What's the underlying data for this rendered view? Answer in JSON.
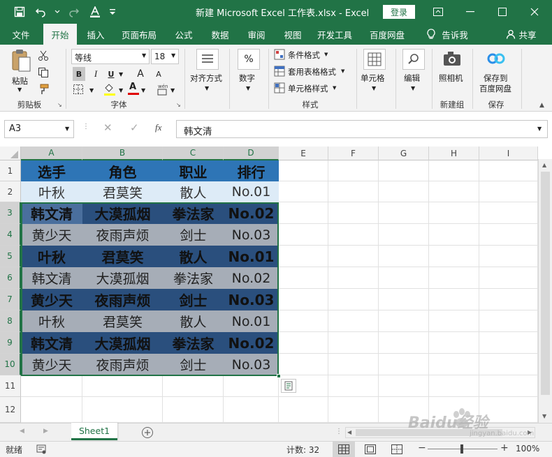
{
  "titlebar": {
    "title": "新建 Microsoft Excel 工作表.xlsx - Excel",
    "login": "登录"
  },
  "tabs": [
    "文件",
    "开始",
    "插入",
    "页面布局",
    "公式",
    "数据",
    "审阅",
    "视图",
    "开发工具",
    "百度网盘",
    "告诉我",
    "共享"
  ],
  "ribbon": {
    "paste": "粘贴",
    "clipboard": "剪贴板",
    "font_name": "等线",
    "font_size": "18",
    "bold": "B",
    "italic": "I",
    "underline": "U",
    "grow": "A",
    "shrink": "A",
    "font_color_letter": "A",
    "font_group": "字体",
    "align": "对齐方式",
    "number": "数字",
    "percent": "%",
    "cond_format": "条件格式",
    "table_format": "套用表格格式",
    "cell_style": "单元格样式",
    "styles_group": "样式",
    "cells": "单元格",
    "edit": "编辑",
    "camera": "照相机",
    "newgroup": "新建组",
    "save_baidu_1": "保存到",
    "save_baidu_2": "百度网盘",
    "save_group": "保存"
  },
  "formula_bar": {
    "name_box": "A3",
    "fx": "fx",
    "content": "韩文清"
  },
  "grid": {
    "columns": [
      "A",
      "B",
      "C",
      "D",
      "E",
      "F",
      "G",
      "H",
      "I"
    ],
    "rows": [
      "1",
      "2",
      "3",
      "4",
      "5",
      "6",
      "7",
      "8",
      "9",
      "10",
      "11",
      "12"
    ],
    "data": [
      [
        "选手",
        "角色",
        "职业",
        "排行"
      ],
      [
        "叶秋",
        "君莫笑",
        "散人",
        "No.01"
      ],
      [
        "韩文清",
        "大漠孤烟",
        "拳法家",
        "No.02"
      ],
      [
        "黄少天",
        "夜雨声烦",
        "剑士",
        "No.03"
      ],
      [
        "叶秋",
        "君莫笑",
        "散人",
        "No.01"
      ],
      [
        "韩文清",
        "大漠孤烟",
        "拳法家",
        "No.02"
      ],
      [
        "黄少天",
        "夜雨声烦",
        "剑士",
        "No.03"
      ],
      [
        "叶秋",
        "君莫笑",
        "散人",
        "No.01"
      ],
      [
        "韩文清",
        "大漠孤烟",
        "拳法家",
        "No.02"
      ],
      [
        "黄少天",
        "夜雨声烦",
        "剑士",
        "No.03"
      ]
    ]
  },
  "colors": {
    "excel_green": "#217346",
    "header_blue": "#2e75b6",
    "light_blue": "#ddebf7",
    "dark_band": "#2a4f7d",
    "gray_band": "#a6adb7"
  },
  "sheets": [
    "Sheet1"
  ],
  "status": {
    "ready": "就绪",
    "count": "计数: 32",
    "zoom": "100%"
  },
  "watermark": {
    "line1": "Baidu经验",
    "line2": "jingyan.baidu.com"
  }
}
